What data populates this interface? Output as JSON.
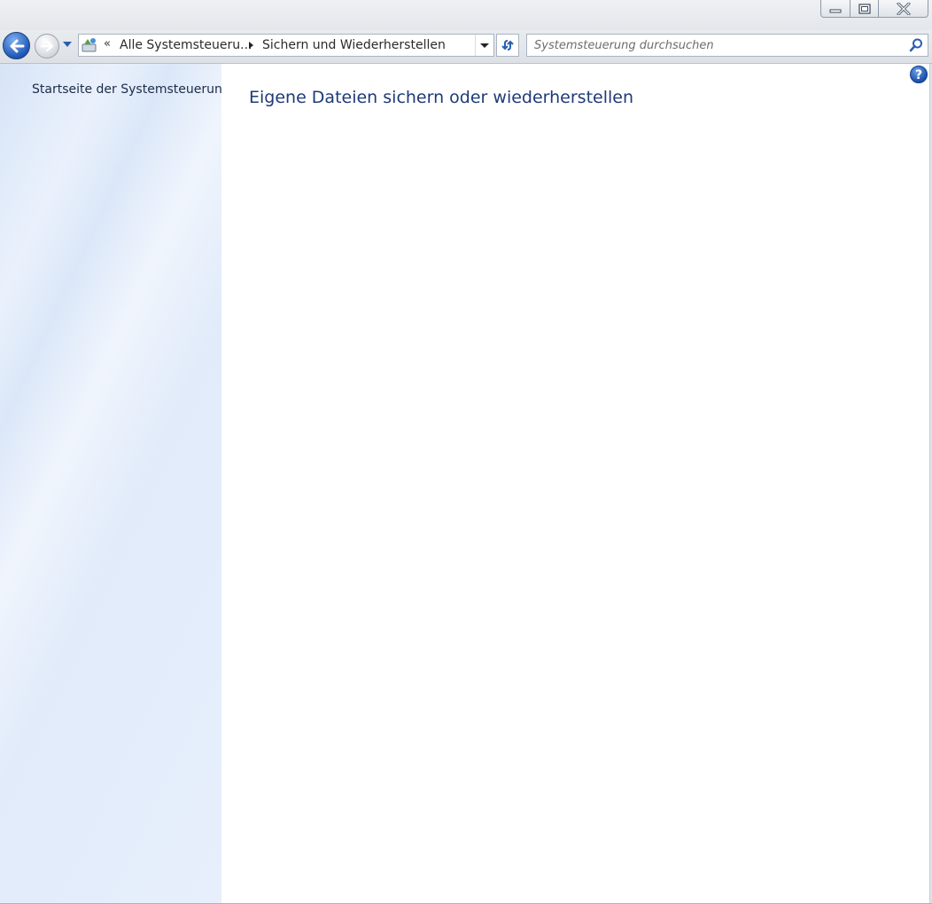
{
  "window": {
    "controls": {
      "minimize_icon": "minimize-icon",
      "maximize_icon": "maximize-icon",
      "close_icon": "close-icon"
    }
  },
  "navigation": {
    "back_icon": "back-arrow-icon",
    "forward_icon": "forward-arrow-icon",
    "history_icon": "chevron-down-icon"
  },
  "address": {
    "location_icon": "control-panel-icon",
    "overflow_chevron": "«",
    "breadcrumbs": [
      "Alle Systemsteueru...",
      "Sichern und Wiederherstellen"
    ],
    "dropdown_icon": "chevron-down-icon",
    "refresh_icon": "refresh-icon"
  },
  "search": {
    "placeholder": "Systemsteuerung durchsuchen",
    "value": "",
    "icon": "search-icon"
  },
  "sidebar": {
    "home_link": "Startseite der Systemsteuerung"
  },
  "main": {
    "title": "Eigene Dateien sichern oder wiederherstellen",
    "help_label": "?"
  },
  "colors": {
    "title": "#1e3a78",
    "link": "#1c2c4a",
    "accent": "#1f58b8"
  }
}
